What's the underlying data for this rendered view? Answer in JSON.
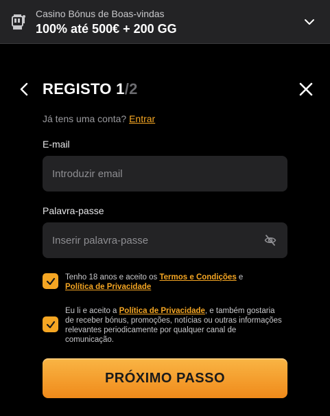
{
  "bonus_bar": {
    "subtitle": "Casino Bónus de Boas-vindas",
    "offer": "100% até 500€ + 200 GG"
  },
  "header": {
    "title": "REGISTO",
    "step_current": "1",
    "step_total": "/2"
  },
  "login_prompt": {
    "text": "Já tens uma conta?",
    "link": "Entrar"
  },
  "email": {
    "label": "E-mail",
    "placeholder": "Introduzir email",
    "value": ""
  },
  "password": {
    "label": "Palavra-passe",
    "placeholder": "Inserir palavra-passe",
    "value": ""
  },
  "consent_terms": {
    "checked": true,
    "text_1": "Tenho 18 anos e aceito os ",
    "link_terms": "Termos e Condições",
    "text_2": " e",
    "link_privacy": "Política de Privacidade"
  },
  "consent_marketing": {
    "checked": true,
    "text_1": "Eu li e aceito a ",
    "link_privacy": "Política de Privacidade",
    "text_2": ", e também gostaria de receber bónus, promoções, notícias ou outras informações relevantes periodicamente por qualquer canal de comunicação."
  },
  "next_button": {
    "label": "PRÓXIMO PASSO"
  },
  "icons": {
    "bonus": "slot-machine-icon",
    "expand": "chevron-down-icon",
    "back": "chevron-left-icon",
    "close": "close-icon",
    "password_toggle": "eye-off-icon",
    "check": "check-icon"
  },
  "colors": {
    "accent": "#f5a623",
    "background": "#000000",
    "field": "#232325"
  }
}
